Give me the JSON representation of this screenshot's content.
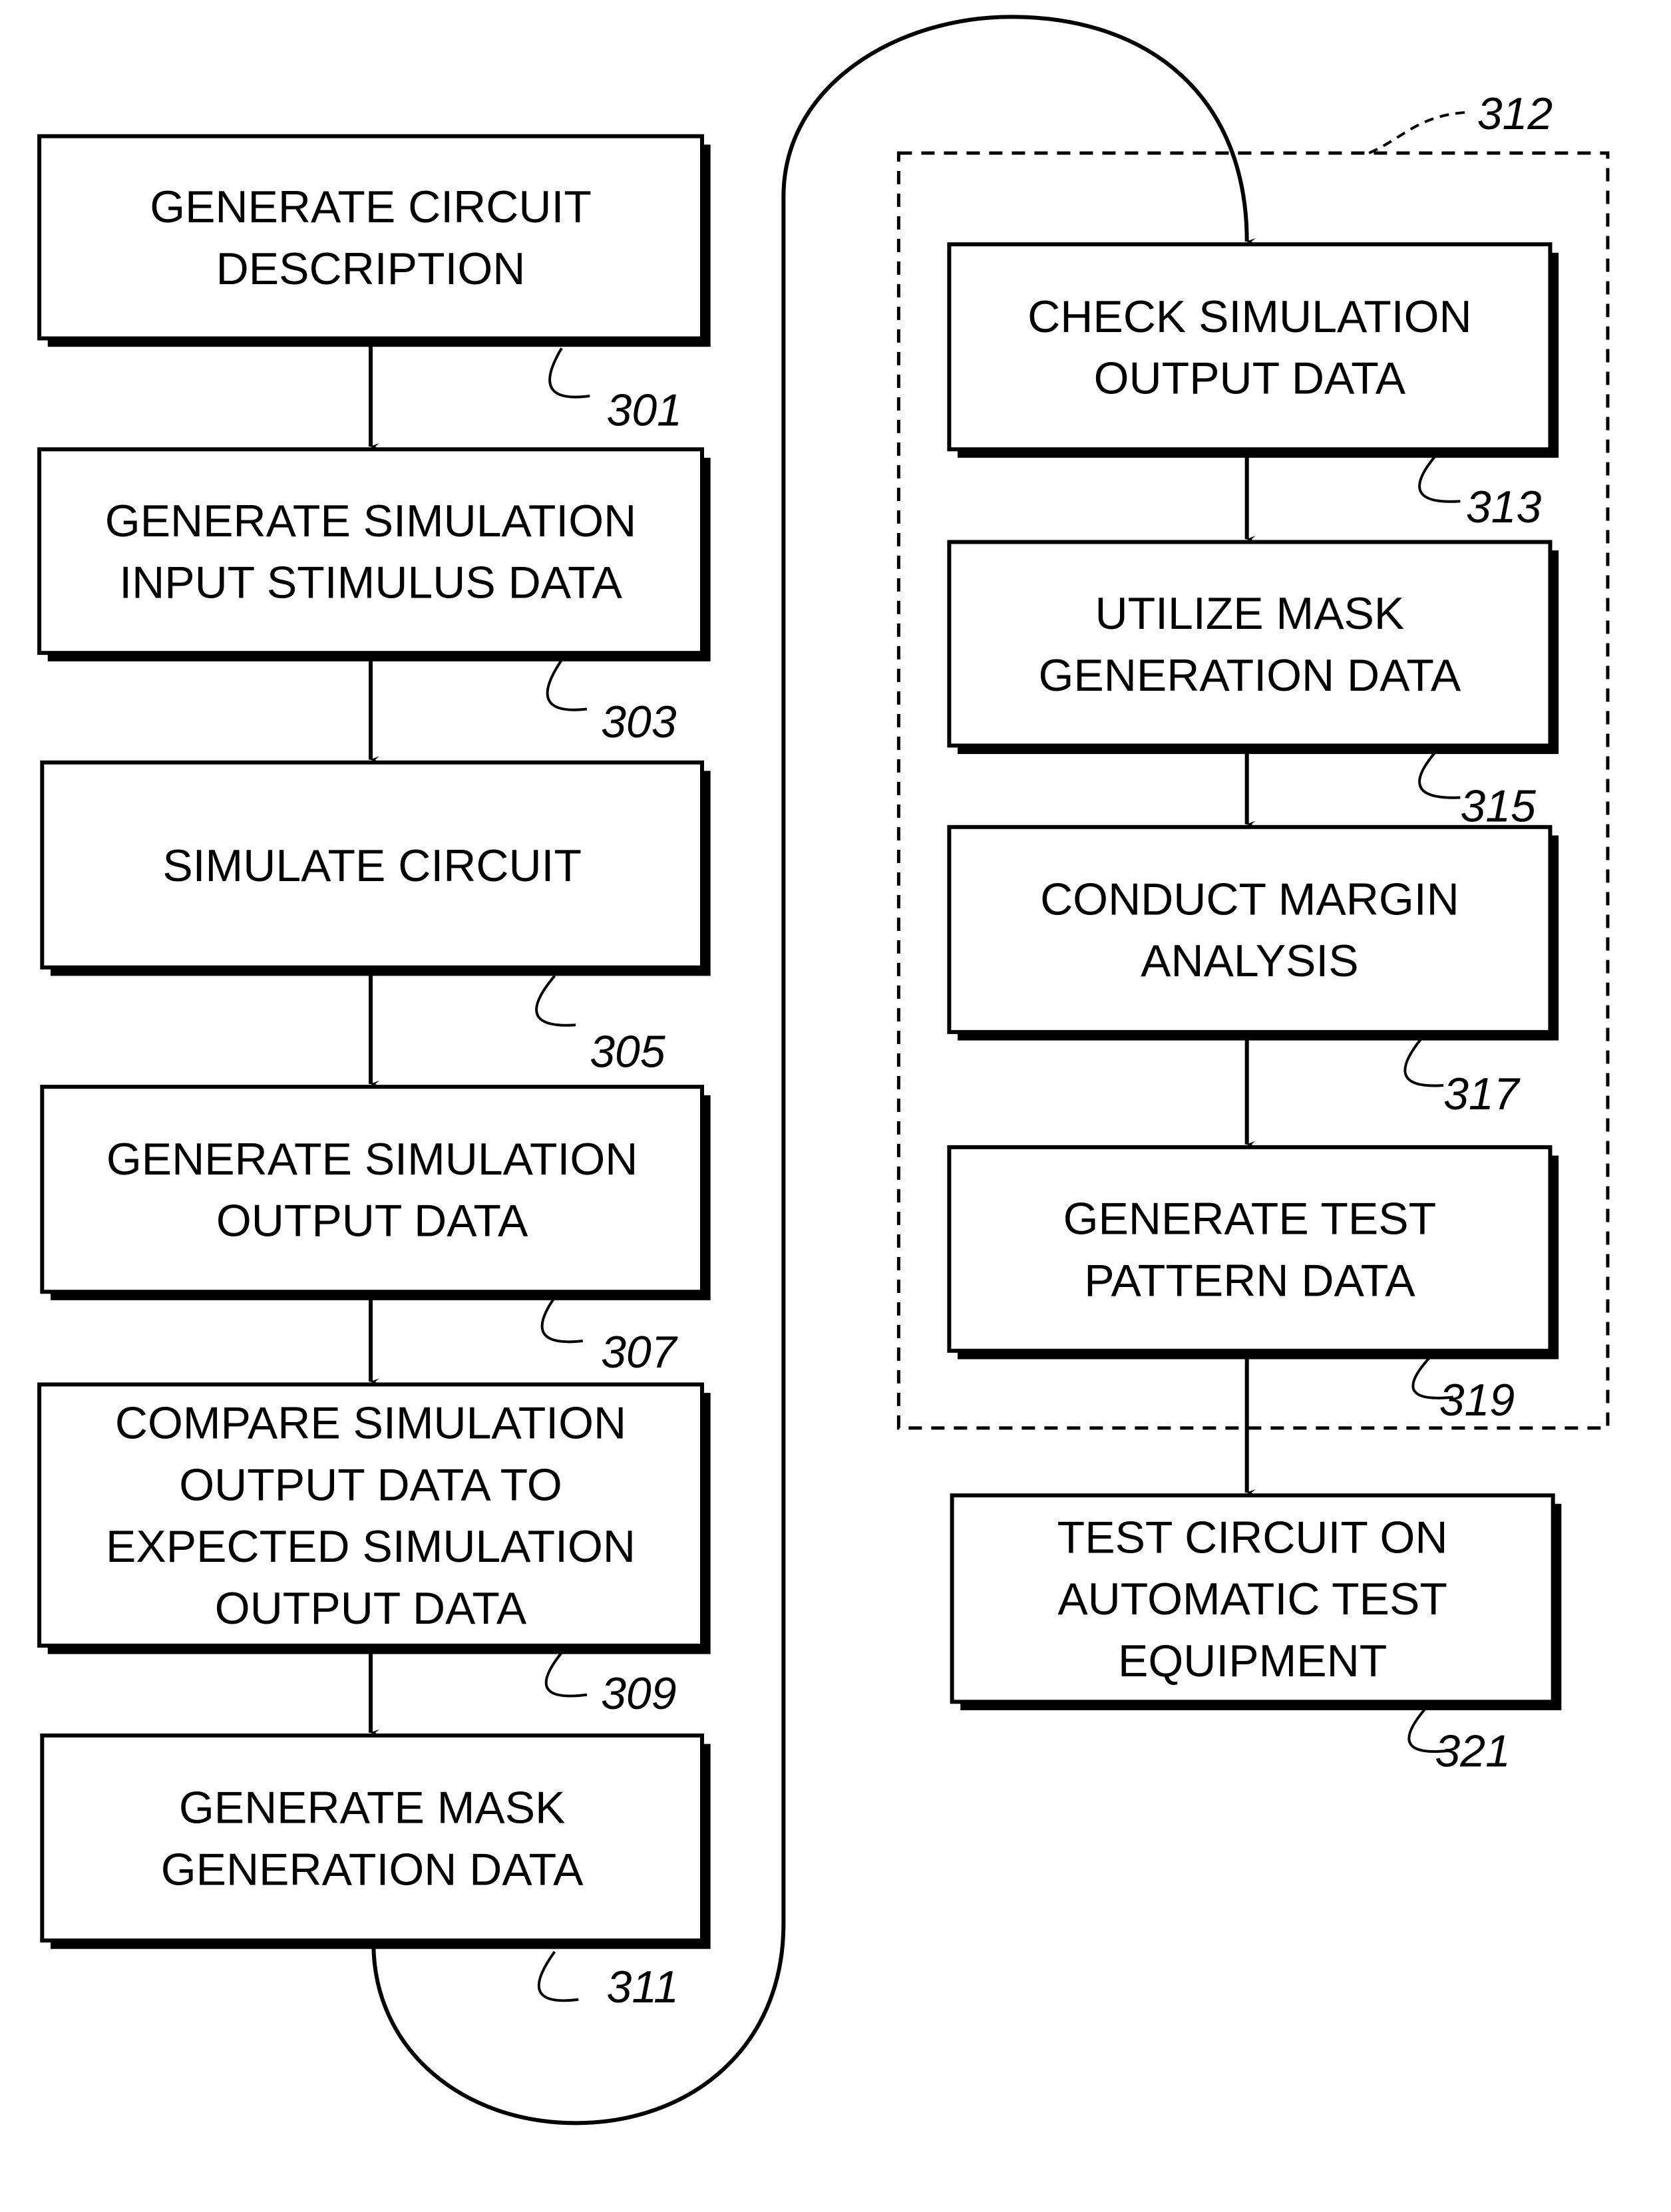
{
  "figure": {
    "description": "Flowchart of circuit design, simulation, and test pattern generation process",
    "left_column": [
      {
        "ref": "301",
        "lines": [
          "GENERATE CIRCUIT",
          "DESCRIPTION"
        ]
      },
      {
        "ref": "303",
        "lines": [
          "GENERATE SIMULATION",
          "INPUT STIMULUS DATA"
        ]
      },
      {
        "ref": "305",
        "lines": [
          "SIMULATE CIRCUIT"
        ]
      },
      {
        "ref": "307",
        "lines": [
          "GENERATE SIMULATION",
          "OUTPUT DATA"
        ]
      },
      {
        "ref": "309",
        "lines": [
          "COMPARE SIMULATION",
          "OUTPUT DATA TO",
          "EXPECTED SIMULATION",
          "OUTPUT DATA"
        ]
      },
      {
        "ref": "311",
        "lines": [
          "GENERATE MASK",
          "GENERATION DATA"
        ]
      }
    ],
    "right_column": [
      {
        "ref": "313",
        "lines": [
          "CHECK SIMULATION",
          "OUTPUT DATA"
        ]
      },
      {
        "ref": "315",
        "lines": [
          "UTILIZE MASK",
          "GENERATION DATA"
        ]
      },
      {
        "ref": "317",
        "lines": [
          "CONDUCT MARGIN",
          "ANALYSIS"
        ]
      },
      {
        "ref": "319",
        "lines": [
          "GENERATE TEST",
          "PATTERN DATA"
        ]
      },
      {
        "ref": "321",
        "lines": [
          "TEST CIRCUIT ON",
          "AUTOMATIC TEST",
          "EQUIPMENT"
        ]
      }
    ],
    "group": {
      "ref": "312",
      "members": [
        "313",
        "315",
        "317",
        "319"
      ]
    }
  }
}
